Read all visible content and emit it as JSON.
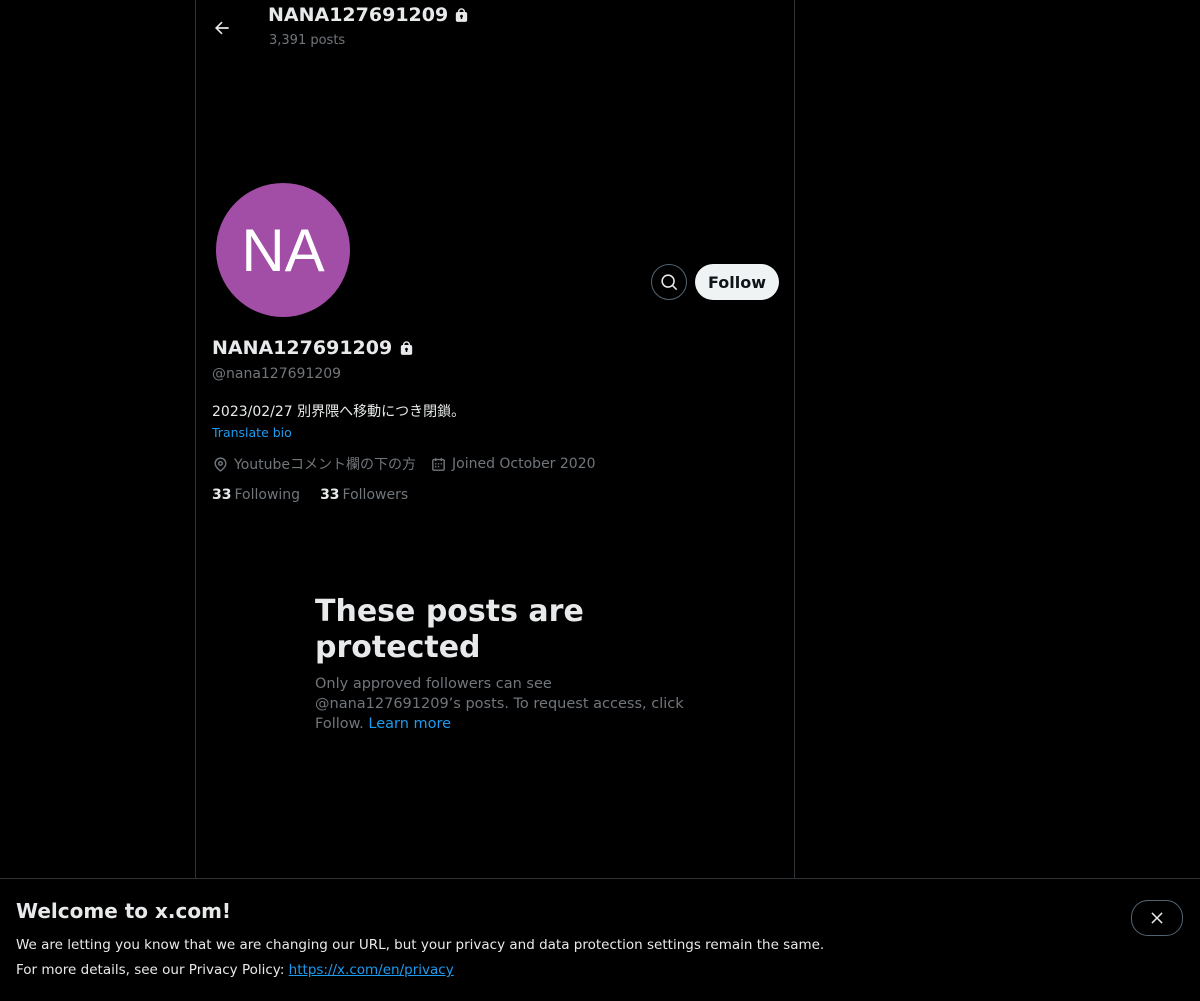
{
  "header": {
    "name": "NANA127691209",
    "posts": "3,391 posts"
  },
  "profile": {
    "avatar_initials": "NA",
    "avatar_color": "#a24da6",
    "follow_label": "Follow",
    "display_name": "NANA127691209",
    "handle": "@nana127691209",
    "bio": "2023/02/27 別界隈へ移動につき閉鎖。",
    "translate_label": "Translate bio",
    "location": "Youtubeコメント欄の下の方",
    "joined": "Joined October 2020",
    "following_count": "33",
    "following_label": "Following",
    "followers_count": "33",
    "followers_label": "Followers"
  },
  "protected": {
    "title": "These posts are protected",
    "text": "Only approved followers can see @nana127691209’s posts. To request access, click Follow.",
    "learn_more": "Learn more"
  },
  "banner": {
    "title": "Welcome to x.com!",
    "line1": "We are letting you know that we are changing our URL, but your privacy and data protection settings remain the same.",
    "line2_prefix": "For more details, see our Privacy Policy:",
    "privacy_link": "https://x.com/en/privacy"
  },
  "icons": {
    "back": "arrow-left-icon",
    "lock": "lock-icon",
    "search": "search-icon",
    "location": "location-pin-icon",
    "calendar": "calendar-icon",
    "close": "close-icon"
  },
  "colors": {
    "background": "#000000",
    "text_primary": "#e7e9ea",
    "text_secondary": "#71767b",
    "link": "#1d9bf0",
    "border": "#2f3336"
  }
}
